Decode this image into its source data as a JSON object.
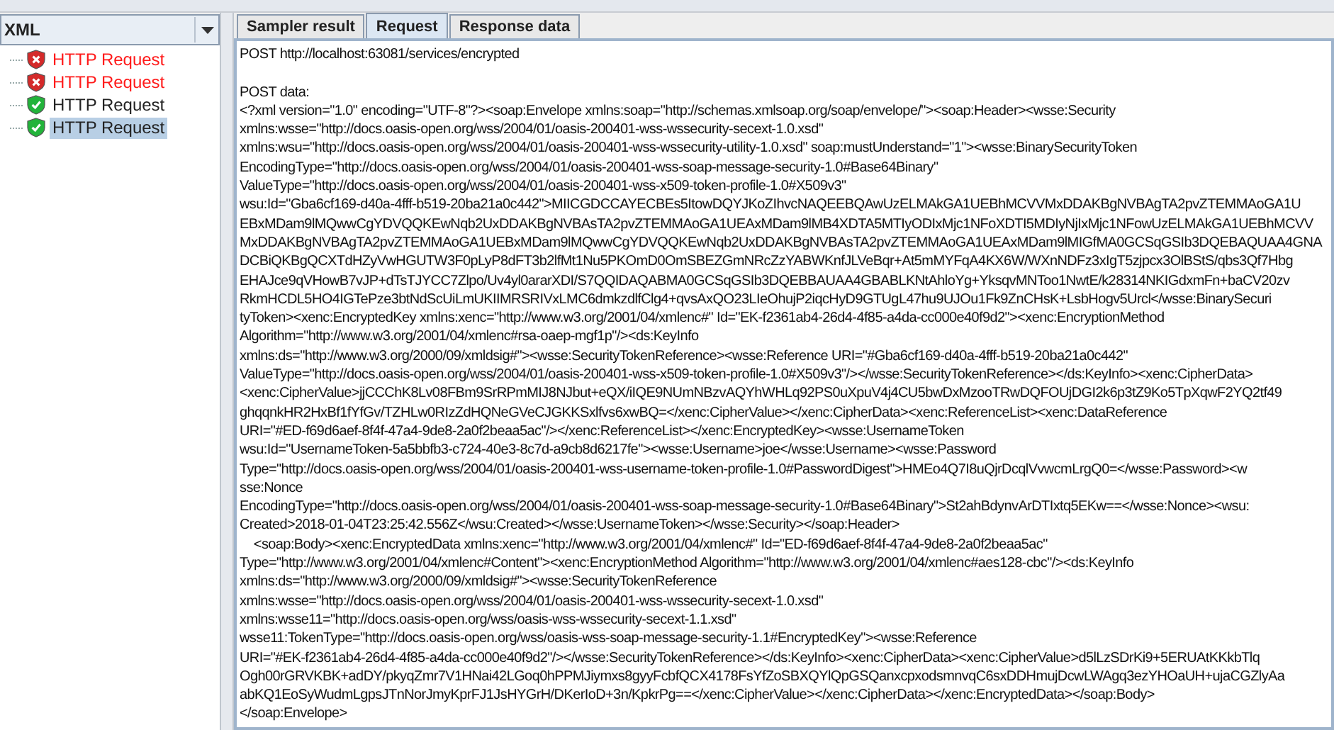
{
  "view_selector": {
    "value": "XML"
  },
  "results_tree": [
    {
      "label": "HTTP Request",
      "kind": "failed",
      "selected": false
    },
    {
      "label": "HTTP Request",
      "kind": "failed",
      "selected": false
    },
    {
      "label": "HTTP Request",
      "kind": "passed",
      "selected": false
    },
    {
      "label": "HTTP Request",
      "kind": "passed",
      "selected": true
    }
  ],
  "tabs": [
    {
      "label": "Sampler result",
      "selected": false
    },
    {
      "label": "Request",
      "selected": true
    },
    {
      "label": "Response data",
      "selected": false
    }
  ],
  "request_lines": [
    "POST http://localhost:63081/services/encrypted",
    "POST data:",
    "<?xml version=\"1.0\" encoding=\"UTF-8\"?><soap:Envelope xmlns:soap=\"http://schemas.xmlsoap.org/soap/envelope/\"><soap:Header><wsse:Security",
    "xmlns:wsse=\"http://docs.oasis-open.org/wss/2004/01/oasis-200401-wss-wssecurity-secext-1.0.xsd\"",
    "xmlns:wsu=\"http://docs.oasis-open.org/wss/2004/01/oasis-200401-wss-wssecurity-utility-1.0.xsd\" soap:mustUnderstand=\"1\"><wsse:BinarySecurityToken",
    "EncodingType=\"http://docs.oasis-open.org/wss/2004/01/oasis-200401-wss-soap-message-security-1.0#Base64Binary\"",
    "ValueType=\"http://docs.oasis-open.org/wss/2004/01/oasis-200401-wss-x509-token-profile-1.0#X509v3\"",
    "wsu:Id=\"Gba6cf169-d40a-4fff-b519-20ba21a0c442\">MIICGDCCAYECBEs5ItowDQYJKoZIhvcNAQEEBQAwUzELMAkGA1UEBhMCVVMxDDAKBgNVBAgTA2pvZTEMMAoGA1U",
    "EBxMDam9lMQwwCgYDVQQKEwNqb2UxDDAKBgNVBAsTA2pvZTEMMAoGA1UEAxMDam9lMB4XDTA5MTIyODIxMjc1NFoXDTI5MDIyNjIxMjc1NFowUzELMAkGA1UEBhMCVV",
    "MxDDAKBgNVBAgTA2pvZTEMMAoGA1UEBxMDam9lMQwwCgYDVQQKEwNqb2UxDDAKBgNVBAsTA2pvZTEMMAoGA1UEAxMDam9lMIGfMA0GCSqGSIb3DQEBAQUAA4GNA",
    "DCBiQKBgQCXTdHZyVwHGUTW3F0pLyP8dFT3b2lfMt1Nu5PKOmD0OmSBEZGmNRcZzYABWKnfJLVeBqr+At5mMYFqA4KX6W/WXnNDFz3xIgT5zjpcx3OlBStS/qbs3Qf7Hbg",
    "EHAJce9qVHowB7vJP+dTsTJYCC7Zlpo/Uv4yl0ararXDI/S7QQIDAQABMA0GCSqGSIb3DQEBBAUAA4GBABLKNtAhloYg+YksqvMNToo1NwtE/k28314NKIGdxmFn+baCV20zv",
    "RkmHCDL5HO4IGTePze3btNdScUiLmUKIIMRSRIVxLMC6dmkzdlfClg4+qvsAxQO23LIeOhujP2iqcHyD9GTUgL47hu9UJOu1Fk9ZnCHsK+LsbHogv5Urcl</wsse:BinarySecuri",
    "tyToken><xenc:EncryptedKey xmlns:xenc=\"http://www.w3.org/2001/04/xmlenc#\" Id=\"EK-f2361ab4-26d4-4f85-a4da-cc000e40f9d2\"><xenc:EncryptionMethod",
    "Algorithm=\"http://www.w3.org/2001/04/xmlenc#rsa-oaep-mgf1p\"/><ds:KeyInfo",
    "xmlns:ds=\"http://www.w3.org/2000/09/xmldsig#\"><wsse:SecurityTokenReference><wsse:Reference URI=\"#Gba6cf169-d40a-4fff-b519-20ba21a0c442\"",
    "ValueType=\"http://docs.oasis-open.org/wss/2004/01/oasis-200401-wss-x509-token-profile-1.0#X509v3\"/></wsse:SecurityTokenReference></ds:KeyInfo><xenc:CipherData>",
    "<xenc:CipherValue>jjCCChK8Lv08FBm9SrRPmMIJ8NJbut+eQX/iIQE9NUmNBzvAQYhWHLq92PS0uXpuV4j4CU5bwDxMzooTRwDQFOUjDGI2k6p3tZ9Ko5TpXqwF2YQ2tf49",
    "ghqqnkHR2HxBf1fYfGv/TZHLw0RIzZdHQNeGVeCJGKKSxlfvs6xwBQ=</xenc:CipherValue></xenc:CipherData><xenc:ReferenceList><xenc:DataReference",
    "URI=\"#ED-f69d6aef-8f4f-47a4-9de8-2a0f2beaa5ac\"/></xenc:ReferenceList></xenc:EncryptedKey><wsse:UsernameToken",
    "wsu:Id=\"UsernameToken-5a5bbfb3-c724-40e3-8c7d-a9cb8d6217fe\"><wsse:Username>joe</wsse:Username><wsse:Password",
    "Type=\"http://docs.oasis-open.org/wss/2004/01/oasis-200401-wss-username-token-profile-1.0#PasswordDigest\">HMEo4Q7I8uQjrDcqlVvwcmLrgQ0=</wsse:Password><w",
    "sse:Nonce",
    "EncodingType=\"http://docs.oasis-open.org/wss/2004/01/oasis-200401-wss-soap-message-security-1.0#Base64Binary\">St2ahBdynvArDTIxtq5EKw==</wsse:Nonce><wsu:",
    "Created>2018-01-04T23:25:42.556Z</wsu:Created></wsse:UsernameToken></wsse:Security></soap:Header>",
    "    <soap:Body><xenc:EncryptedData xmlns:xenc=\"http://www.w3.org/2001/04/xmlenc#\" Id=\"ED-f69d6aef-8f4f-47a4-9de8-2a0f2beaa5ac\"",
    "Type=\"http://www.w3.org/2001/04/xmlenc#Content\"><xenc:EncryptionMethod Algorithm=\"http://www.w3.org/2001/04/xmlenc#aes128-cbc\"/><ds:KeyInfo",
    "xmlns:ds=\"http://www.w3.org/2000/09/xmldsig#\"><wsse:SecurityTokenReference",
    "xmlns:wsse=\"http://docs.oasis-open.org/wss/2004/01/oasis-200401-wss-wssecurity-secext-1.0.xsd\"",
    "xmlns:wsse11=\"http://docs.oasis-open.org/wss/oasis-wss-wssecurity-secext-1.1.xsd\"",
    "wsse11:TokenType=\"http://docs.oasis-open.org/wss/oasis-wss-soap-message-security-1.1#EncryptedKey\"><wsse:Reference",
    "URI=\"#EK-f2361ab4-26d4-4f85-a4da-cc000e40f9d2\"/></wsse:SecurityTokenReference></ds:KeyInfo><xenc:CipherData><xenc:CipherValue>d5lLzSDrKi9+5ERUAtKKkbTlq",
    "Ogh00rGRVKBK+adDY/pkyqZmr7V1HNai42LGoq0hPPMJiymxs8gyyFcbfQCX4178FsYfZoSBXQYlQpGSQanxcpxodsmnvqC6sxDDHmujDcwLWAgq3ezYHOaUH+ujaCGZlyAa",
    "abKQ1EoSyWudmLgpsJTnNorJmyKprFJ1JsHYGrH/DKerIoD+3n/KpkrPg==</xenc:CipherValue></xenc:CipherData></xenc:EncryptedData></soap:Body>",
    "</soap:Envelope>"
  ]
}
